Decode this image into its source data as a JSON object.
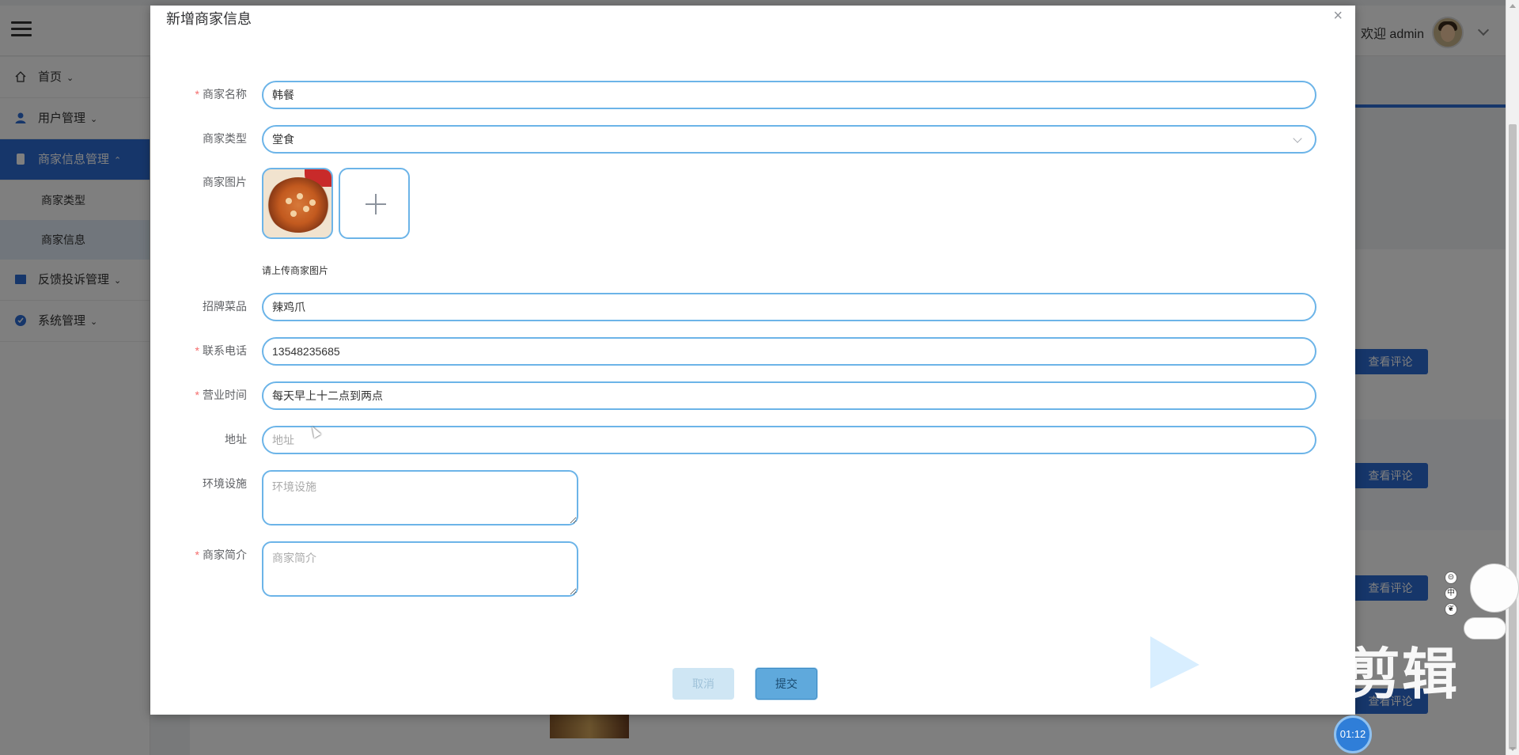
{
  "header": {
    "welcome": "欢迎 admin"
  },
  "sidebar": {
    "items": [
      {
        "label": "首页",
        "caret": "⌄"
      },
      {
        "label": "用户管理",
        "caret": "⌄"
      },
      {
        "label": "商家信息管理",
        "caret": "⌃"
      },
      {
        "label": "反馈投诉管理",
        "caret": "⌄"
      },
      {
        "label": "系统管理",
        "caret": "⌄"
      }
    ],
    "subitems": [
      {
        "label": "商家类型"
      },
      {
        "label": "商家信息"
      }
    ]
  },
  "background": {
    "view_comment_label": "查看评论"
  },
  "dialog": {
    "title": "新增商家信息",
    "close_glyph": "×",
    "required_mark": "*",
    "fields": {
      "name": {
        "label": "商家名称",
        "value": "韩餐"
      },
      "type": {
        "label": "商家类型",
        "value": "堂食"
      },
      "image": {
        "label": "商家图片",
        "tip": "请上传商家图片"
      },
      "dish": {
        "label": "招牌菜品",
        "value": "辣鸡爪"
      },
      "phone": {
        "label": "联系电话",
        "value": "13548235685"
      },
      "hours": {
        "label": "营业时间",
        "value": "每天早上十二点到两点"
      },
      "address": {
        "label": "地址",
        "placeholder": "地址"
      },
      "facilities": {
        "label": "环境设施",
        "placeholder": "环境设施"
      },
      "intro": {
        "label": "商家简介",
        "placeholder": "商家简介"
      }
    },
    "buttons": {
      "cancel": "取消",
      "submit": "提交"
    }
  },
  "overlay": {
    "watermark_text": "剪辑",
    "timer": "01:12",
    "chips": [
      "⊝",
      "中",
      "❦"
    ]
  },
  "colors": {
    "accent": "#2d6dd5",
    "input_border": "#6cb4e8",
    "required": "#f56c6c"
  }
}
